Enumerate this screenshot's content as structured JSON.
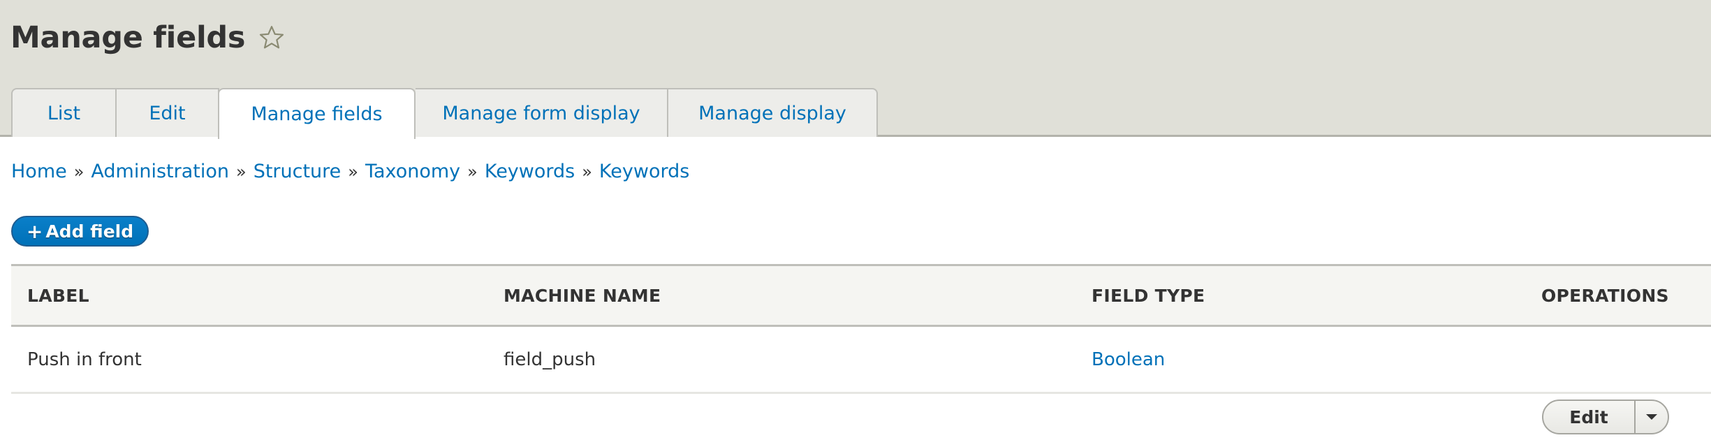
{
  "header": {
    "title": "Manage fields",
    "favorite_icon": "star-outline-icon"
  },
  "tabs": [
    {
      "label": "List",
      "active": false
    },
    {
      "label": "Edit",
      "active": false
    },
    {
      "label": "Manage fields",
      "active": true
    },
    {
      "label": "Manage form display",
      "active": false
    },
    {
      "label": "Manage display",
      "active": false
    }
  ],
  "breadcrumb": {
    "separator": "»",
    "items": [
      "Home",
      "Administration",
      "Structure",
      "Taxonomy",
      "Keywords",
      "Keywords"
    ]
  },
  "actions": {
    "add_field_icon": "+",
    "add_field_label": "Add field"
  },
  "table": {
    "columns": [
      "LABEL",
      "MACHINE NAME",
      "FIELD TYPE",
      "OPERATIONS"
    ],
    "rows": [
      {
        "label": "Push in front",
        "machine_name": "field_push",
        "field_type": "Boolean",
        "operation": "Edit"
      }
    ]
  },
  "colors": {
    "link": "#0071b8",
    "header_bg": "#e0e0d8",
    "button_primary": "#0071b8"
  }
}
